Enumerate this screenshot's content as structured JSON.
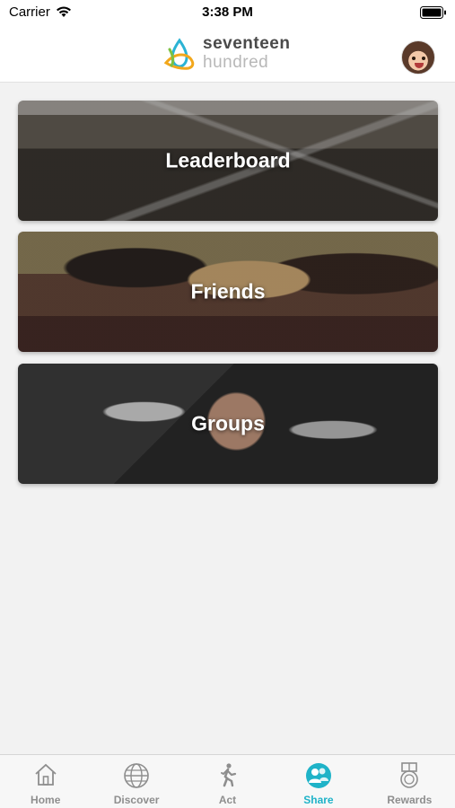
{
  "status_bar": {
    "carrier": "Carrier",
    "time": "3:38 PM",
    "wifi_icon": "wifi-icon",
    "battery_icon": "battery-icon"
  },
  "header": {
    "logo_line1": "seventeen",
    "logo_line2": "hundred",
    "avatar": "profile-avatar"
  },
  "cards": [
    {
      "label": "Leaderboard",
      "image": "runners-at-start-line"
    },
    {
      "label": "Friends",
      "image": "friends-arms-around-shoulders"
    },
    {
      "label": "Groups",
      "image": "group-lying-in-circle"
    }
  ],
  "tab_bar": {
    "active": "Share",
    "accent_color": "#1fb3c8",
    "inactive_color": "#8e8e8e",
    "tabs": [
      {
        "label": "Home",
        "icon": "home-icon"
      },
      {
        "label": "Discover",
        "icon": "globe-icon"
      },
      {
        "label": "Act",
        "icon": "walking-person-icon"
      },
      {
        "label": "Share",
        "icon": "people-icon"
      },
      {
        "label": "Rewards",
        "icon": "medal-icon"
      }
    ]
  }
}
